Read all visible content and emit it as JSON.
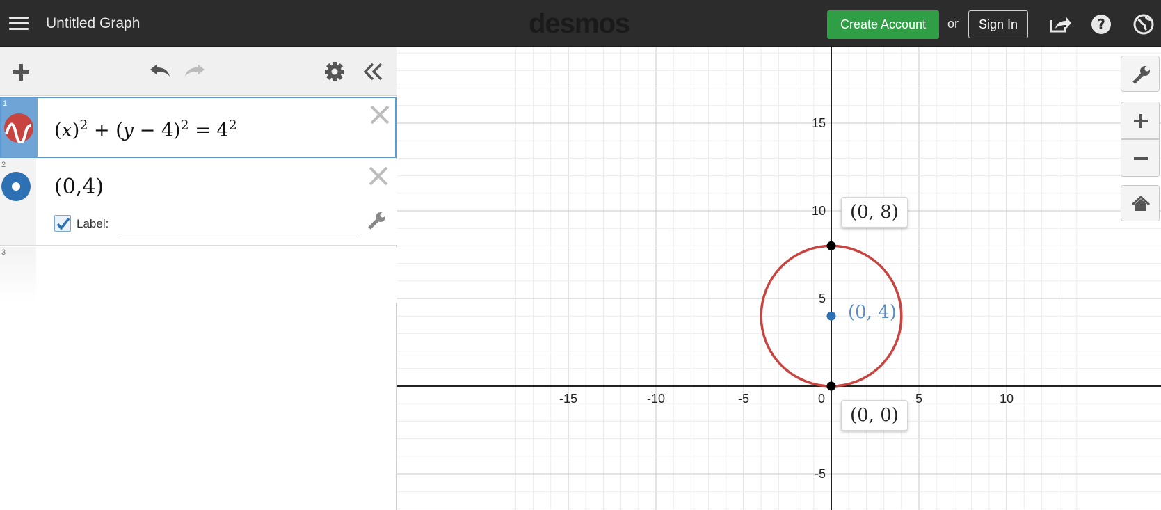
{
  "header": {
    "title": "Untitled Graph",
    "brand": "desmos",
    "create_account": "Create Account",
    "or": "or",
    "sign_in": "Sign In"
  },
  "expressions": [
    {
      "number": "1",
      "latex_display": "(x)^2 + (y − 4)^2 = 4^2",
      "color": "#c74440"
    },
    {
      "number": "2",
      "latex_display": "(0,4)",
      "color": "#2d70b3",
      "label_checked": true,
      "label_text": "Label:",
      "label_value": ""
    },
    {
      "number": "3"
    }
  ],
  "chart_data": {
    "type": "scatter",
    "xlim": [
      -18.5,
      14
    ],
    "ylim": [
      -7,
      19
    ],
    "x_ticks": [
      -15,
      -10,
      -5,
      0,
      5,
      10
    ],
    "y_ticks": [
      -5,
      5,
      10,
      15
    ],
    "grid": true,
    "curves": [
      {
        "kind": "circle",
        "equation": "(x)^2 + (y - 4)^2 = 4^2",
        "center": [
          0,
          4
        ],
        "radius": 4,
        "color": "#c74440"
      }
    ],
    "points": [
      {
        "x": 0,
        "y": 4,
        "label": "(0, 4)",
        "color": "#2d70b3"
      },
      {
        "x": 0,
        "y": 8,
        "label": "(0, 8)",
        "color": "#000000"
      },
      {
        "x": 0,
        "y": 0,
        "label": "(0, 0)",
        "color": "#000000"
      }
    ]
  },
  "colors": {
    "header_bg": "#2c2c2c",
    "accent_green": "#2f9e45",
    "selected_blue": "#6ea4d6"
  }
}
